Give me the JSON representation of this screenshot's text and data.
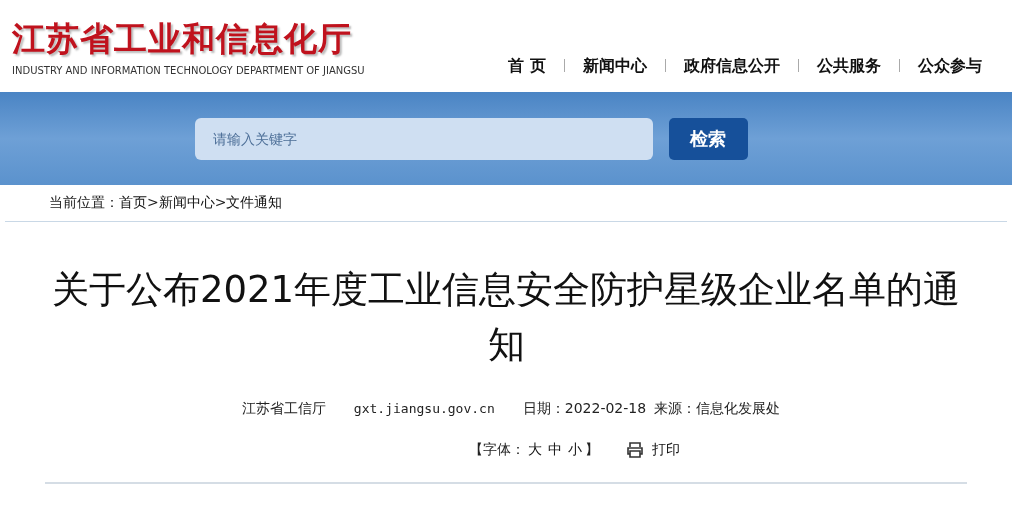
{
  "header": {
    "logo_title": "江苏省工业和信息化厅",
    "logo_subtitle": "INDUSTRY AND INFORMATION TECHNOLOGY DEPARTMENT OF JIANGSU"
  },
  "nav": [
    {
      "label": "首 页"
    },
    {
      "label": "新闻中心"
    },
    {
      "label": "政府信息公开"
    },
    {
      "label": "公共服务"
    },
    {
      "label": "公众参与"
    }
  ],
  "search": {
    "placeholder": "请输入关键字",
    "button": "检索"
  },
  "breadcrumb": {
    "label": "当前位置：",
    "items": [
      {
        "kind": "link",
        "text": "首页"
      },
      {
        "kind": "sep",
        "text": ">"
      },
      {
        "kind": "link",
        "text": "新闻中心"
      },
      {
        "kind": "sep",
        "text": ">"
      },
      {
        "kind": "link",
        "text": "文件通知"
      }
    ]
  },
  "article": {
    "title": "关于公布2021年度工业信息安全防护星级企业名单的通知",
    "publisher": "江苏省工信厅",
    "site": "gxt.jiangsu.gov.cn",
    "date": "日期：2022-02-18",
    "source": "来源：信息化发展处",
    "font_tools": [
      {
        "kind": "text",
        "text": "【字体："
      },
      {
        "kind": "link",
        "text": "大"
      },
      {
        "kind": "link",
        "text": "中"
      },
      {
        "kind": "link",
        "text": "小"
      },
      {
        "kind": "text",
        "text": "】"
      }
    ],
    "print": "打印"
  }
}
